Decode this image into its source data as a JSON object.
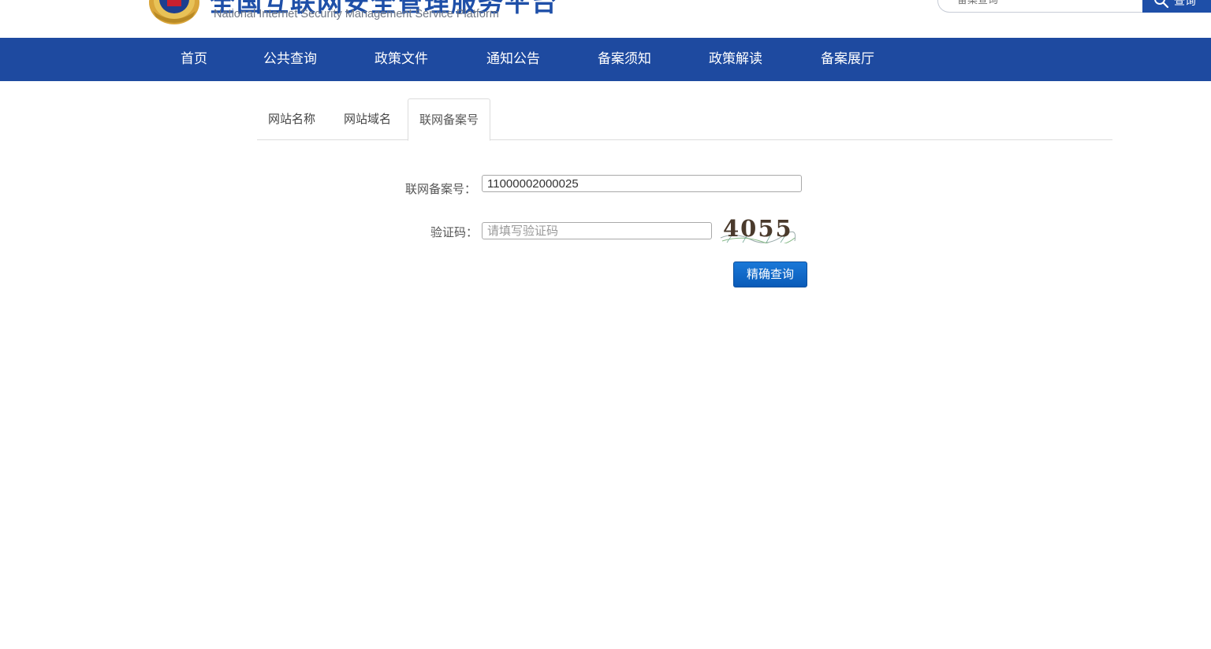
{
  "header": {
    "title": "全国互联网安全管理服务平台",
    "subtitle": "National Internet Security Management Service Platform",
    "search_placeholder": "备案查询",
    "search_button": "查询"
  },
  "nav": {
    "items": [
      "首页",
      "公共查询",
      "政策文件",
      "通知公告",
      "备案须知",
      "政策解读",
      "备案展厅"
    ]
  },
  "tabs": {
    "items": [
      "网站名称",
      "网站域名",
      "联网备案号"
    ],
    "active": "联网备案号"
  },
  "form": {
    "record_label": "联网备案号：",
    "record_value": "11000002000025",
    "captcha_label": "验证码：",
    "captcha_placeholder": "请填写验证码",
    "captcha_text": "4055",
    "submit_label": "精确查询"
  },
  "colors": {
    "brand_blue": "#1e4aa0",
    "button_blue": "#0a5bb8"
  },
  "icons": {
    "emblem": "police-emblem-icon",
    "search": "search-icon"
  }
}
